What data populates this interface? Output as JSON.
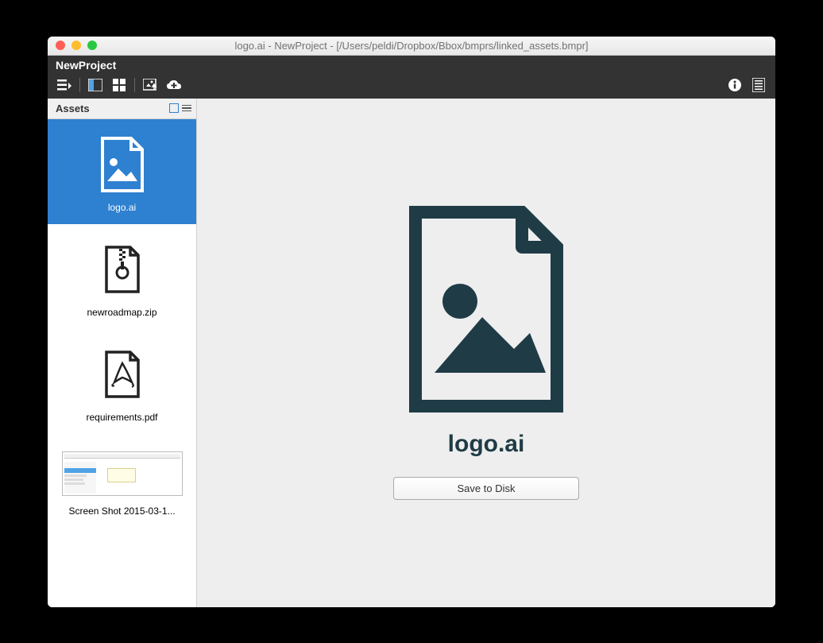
{
  "titlebar": {
    "text": "logo.ai - NewProject - [/Users/peldi/Dropbox/Bbox/bmprs/linked_assets.bmpr]"
  },
  "projectbar": {
    "name": "NewProject"
  },
  "sidebar": {
    "title": "Assets",
    "items": [
      {
        "label": "logo.ai",
        "type": "image",
        "selected": true
      },
      {
        "label": "newroadmap.zip",
        "type": "zip",
        "selected": false
      },
      {
        "label": "requirements.pdf",
        "type": "pdf",
        "selected": false
      },
      {
        "label": "Screen Shot 2015-03-1...",
        "type": "screenshot",
        "selected": false
      }
    ]
  },
  "preview": {
    "filename": "logo.ai",
    "save_label": "Save to Disk"
  }
}
